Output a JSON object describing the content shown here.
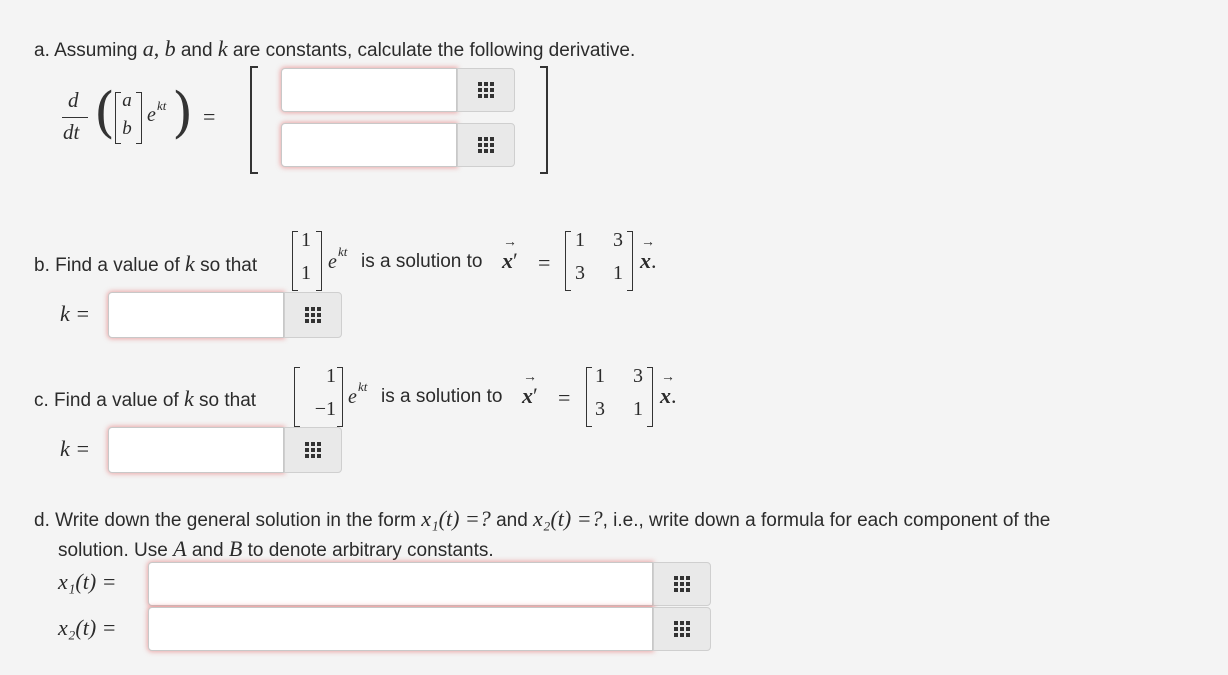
{
  "part_a": {
    "prefix": "a. Assuming",
    "var_a": "a",
    "comma": ",",
    "var_b": "b",
    "and_text": "and",
    "var_k": "k",
    "suffix": "are constants, calculate the following derivative.",
    "frac_num": "d",
    "frac_den": "dt",
    "vec_top": "a",
    "vec_bot": "b",
    "exp_base": "e",
    "exp_power": "kt",
    "equals": "=",
    "input_top": {
      "value": "",
      "placeholder": ""
    },
    "input_bottom": {
      "value": "",
      "placeholder": ""
    }
  },
  "part_b": {
    "prefix": "b. Find a value of",
    "var_k": "k",
    "so_that": "so that",
    "vec_top": "1",
    "vec_bot": "1",
    "exp_base": "e",
    "exp_power": "kt",
    "is_solution": "is a solution to",
    "xvec": "x",
    "prime": "′",
    "equals": "=",
    "matrix": [
      "1",
      "3",
      "3",
      "1"
    ],
    "period": ".",
    "answer_label": "k =",
    "input": {
      "value": "",
      "placeholder": ""
    }
  },
  "part_c": {
    "prefix": "c. Find a value of",
    "var_k": "k",
    "so_that": "so that",
    "vec_top": "1",
    "vec_bot": "−1",
    "exp_base": "e",
    "exp_power": "kt",
    "is_solution": "is a solution to",
    "xvec": "x",
    "prime": "′",
    "equals": "=",
    "matrix": [
      "1",
      "3",
      "3",
      "1"
    ],
    "period": ".",
    "answer_label": "k =",
    "input": {
      "value": "",
      "placeholder": ""
    }
  },
  "part_d": {
    "line1_prefix": "d. Write down the general solution in the form",
    "x1_eq": "x₁(t) =?",
    "and_text": "and",
    "x2_eq": "x₂(t) =?",
    "line1_suffix": ", i.e., write down a formula for each component of the",
    "line2_prefix": "solution. Use",
    "var_A": "A",
    "and2": "and",
    "var_B": "B",
    "line2_suffix": "to denote arbitrary constants.",
    "label_x1": "x₁(t) =",
    "label_x2": "x₂(t) =",
    "input_x1": {
      "value": "",
      "placeholder": ""
    },
    "input_x2": {
      "value": "",
      "placeholder": ""
    }
  },
  "icons": {
    "keypad": "keypad-grid-icon"
  },
  "colors": {
    "field_glow": "#e66e6e",
    "background": "#f4f4f4",
    "button_bg": "#e9e9e9"
  }
}
